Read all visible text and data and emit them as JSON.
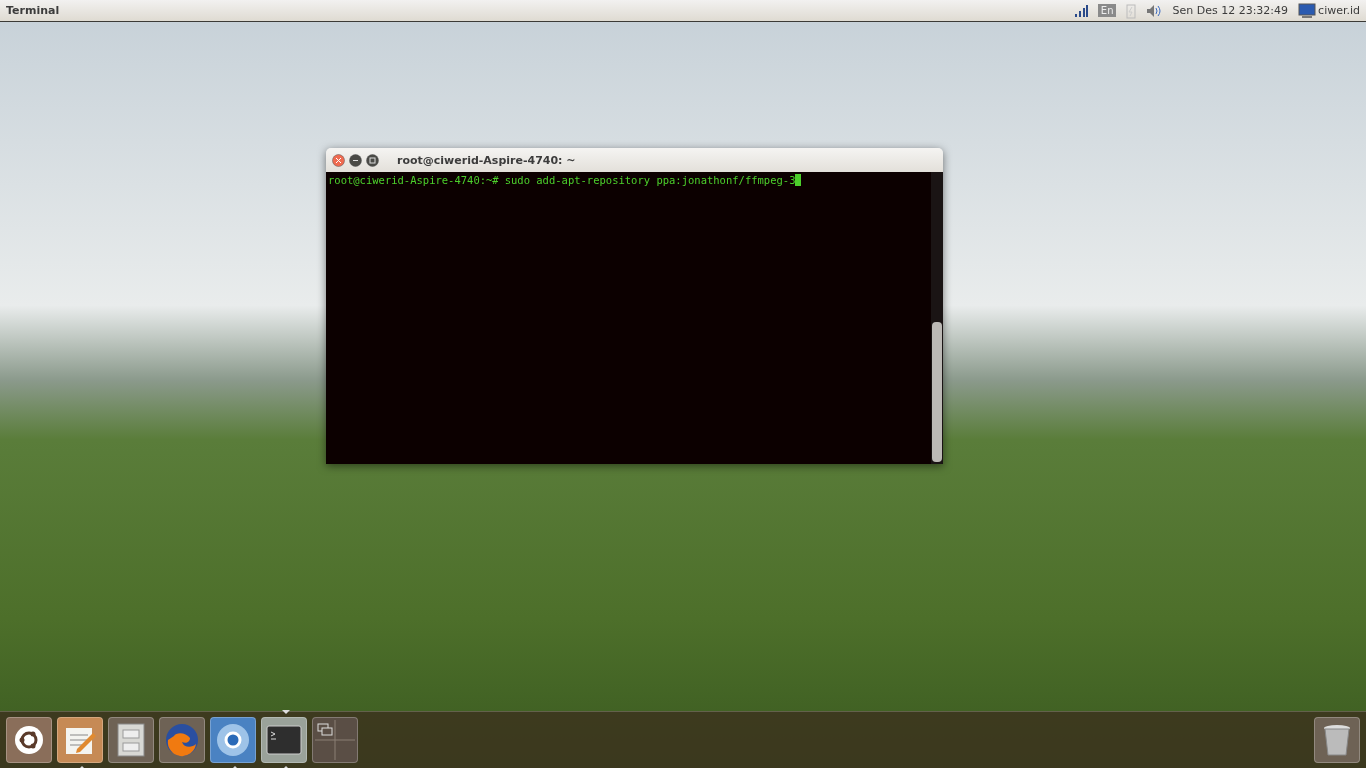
{
  "top_bar": {
    "app_title": "Terminal",
    "keyboard_layout": "En",
    "clock": "Sen Des 12 23:32:49",
    "user": "ciwer.id"
  },
  "terminal": {
    "title": "root@ciwerid-Aspire-4740: ~",
    "prompt": "root@ciwerid-Aspire-4740:~#",
    "command": "sudo add-apt-repository ppa:jonathonf/ffmpeg-3"
  },
  "dock": {
    "items": [
      {
        "kind": "home",
        "running": false,
        "active": false
      },
      {
        "kind": "editor",
        "running": true,
        "active": false
      },
      {
        "kind": "files",
        "running": false,
        "active": false
      },
      {
        "kind": "firefox",
        "running": false,
        "active": false
      },
      {
        "kind": "chromium",
        "running": true,
        "active": false
      },
      {
        "kind": "terminal",
        "running": true,
        "active": true
      },
      {
        "kind": "workspaces",
        "running": false,
        "active": false
      }
    ],
    "trash": {
      "kind": "trash"
    }
  }
}
